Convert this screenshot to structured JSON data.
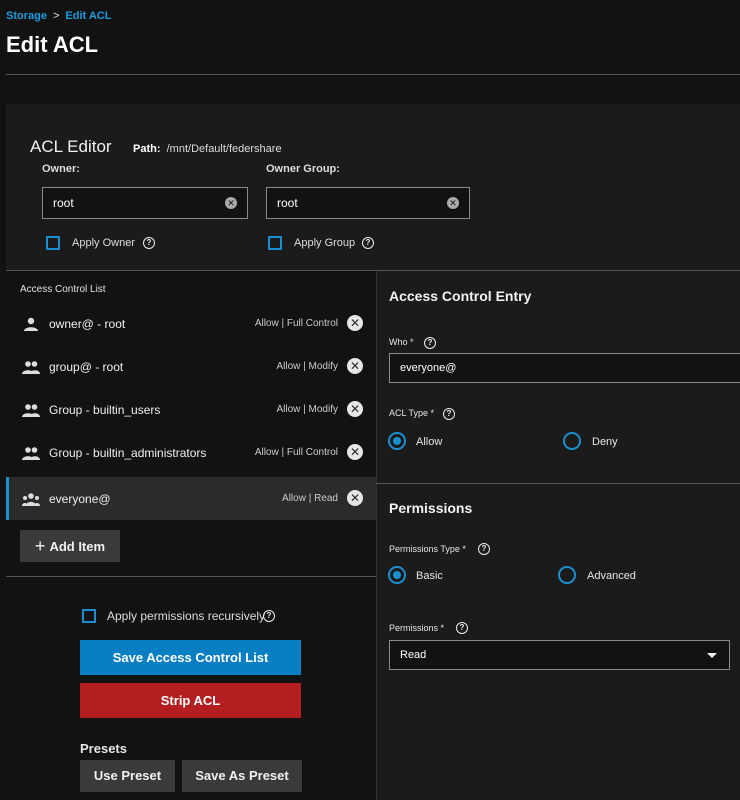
{
  "breadcrumb": {
    "parent": "Storage",
    "separator": ">",
    "current": "Edit ACL"
  },
  "page_title": "Edit ACL",
  "acl_editor": {
    "title": "ACL Editor",
    "path_label": "Path:",
    "path_value": "/mnt/Default/federshare",
    "owner": {
      "label": "Owner:",
      "value": "root",
      "apply_label": "Apply Owner"
    },
    "owner_group": {
      "label": "Owner Group:",
      "value": "root",
      "apply_label": "Apply Group"
    }
  },
  "acl_list": {
    "heading": "Access Control List",
    "items": [
      {
        "icon": "user-icon",
        "name": "owner@ - root",
        "perm": "Allow | Full Control"
      },
      {
        "icon": "group-icon",
        "name": "group@ - root",
        "perm": "Allow | Modify"
      },
      {
        "icon": "group-icon",
        "name": "Group - builtin_users",
        "perm": "Allow | Modify"
      },
      {
        "icon": "group-icon",
        "name": "Group - builtin_administrators",
        "perm": "Allow | Full Control"
      },
      {
        "icon": "everyone-icon",
        "name": "everyone@",
        "perm": "Allow | Read",
        "selected": true
      }
    ],
    "add_item_label": "Add Item"
  },
  "actions": {
    "recursive_label": "Apply permissions recursively",
    "save_label": "Save Access Control List",
    "strip_label": "Strip ACL",
    "presets_heading": "Presets",
    "use_preset_label": "Use Preset",
    "save_preset_label": "Save As Preset"
  },
  "entry": {
    "title": "Access Control Entry",
    "who_label": "Who",
    "who_value": "everyone@",
    "acl_type_label": "ACL Type",
    "acl_type_options": [
      "Allow",
      "Deny"
    ],
    "acl_type_selected": "Allow"
  },
  "permissions": {
    "title": "Permissions",
    "type_label": "Permissions Type",
    "type_options": [
      "Basic",
      "Advanced"
    ],
    "type_selected": "Basic",
    "perm_label": "Permissions",
    "perm_value": "Read"
  },
  "colors": {
    "accent": "#1a8fd0",
    "danger": "#b41e20",
    "primary": "#0a7ec2"
  }
}
